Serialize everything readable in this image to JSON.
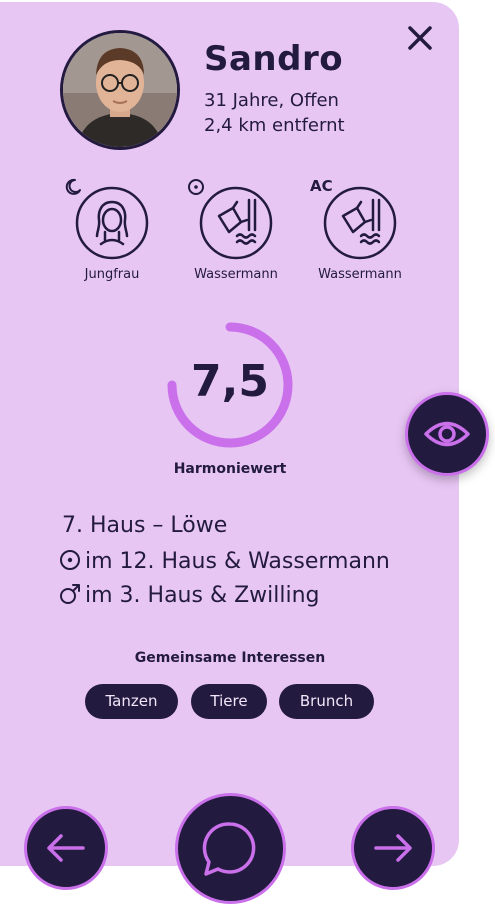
{
  "profile": {
    "name": "Sandro",
    "age_status": "31 Jahre, Offen",
    "distance": "2,4 km entfernt"
  },
  "signs": [
    {
      "prefix_icon": "moon-icon",
      "label": "Jungfrau",
      "icon": "virgo-icon"
    },
    {
      "prefix_icon": "sun-icon",
      "label": "Wassermann",
      "icon": "aquarius-icon"
    },
    {
      "prefix": "AC",
      "label": "Wassermann",
      "icon": "aquarius-icon"
    }
  ],
  "score": {
    "value": "7,5",
    "fraction": 0.75,
    "label": "Harmoniewert"
  },
  "houses": [
    {
      "icon": "none",
      "text": "7. Haus – Löwe"
    },
    {
      "icon": "sun-icon",
      "text": "im 12. Haus & Wassermann"
    },
    {
      "icon": "mars-icon",
      "text": "im 3. Haus & Zwilling"
    }
  ],
  "interests": {
    "title": "Gemeinsame Interessen",
    "chips": [
      "Tanzen",
      "Tiere",
      "Brunch"
    ]
  },
  "colors": {
    "card": "#e8c6f4",
    "dark": "#231a3f",
    "accent": "#c970ea"
  }
}
